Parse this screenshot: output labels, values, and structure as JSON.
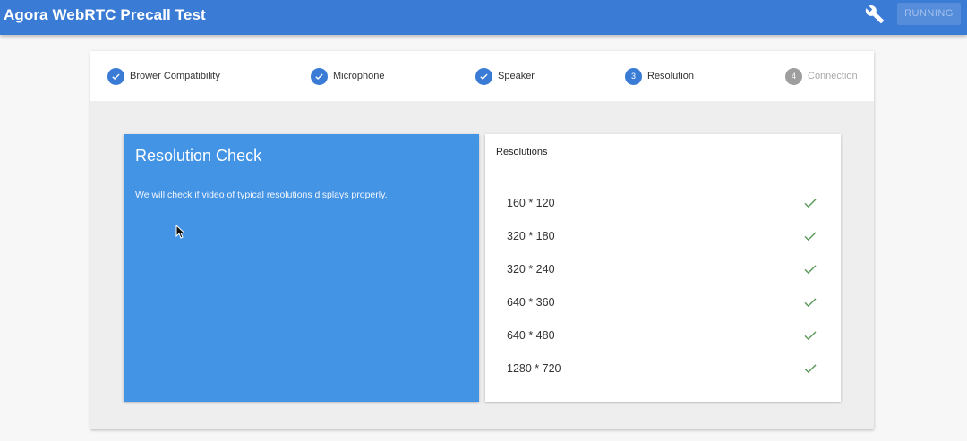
{
  "header": {
    "title": "Agora WebRTC Precall Test",
    "settings_icon": "wrench-icon",
    "running_label": "RUNNING"
  },
  "stepper": {
    "steps": [
      {
        "label": "Brower Compatibility",
        "state": "done",
        "number": ""
      },
      {
        "label": "Microphone",
        "state": "done",
        "number": ""
      },
      {
        "label": "Speaker",
        "state": "done",
        "number": ""
      },
      {
        "label": "Resolution",
        "state": "active",
        "number": "3"
      },
      {
        "label": "Connection",
        "state": "pending",
        "number": "4"
      }
    ]
  },
  "resolution_check": {
    "title": "Resolution Check",
    "description": "We will check if video of typical resolutions displays properly."
  },
  "resolutions": {
    "title": "Resolutions",
    "items": [
      {
        "label": "160 * 120",
        "status": "check-icon"
      },
      {
        "label": "320 * 180",
        "status": "check-icon"
      },
      {
        "label": "320 * 240",
        "status": "check-icon"
      },
      {
        "label": "640 * 360",
        "status": "check-icon"
      },
      {
        "label": "640 * 480",
        "status": "check-icon"
      },
      {
        "label": "1280 * 720",
        "status": "check-icon"
      }
    ]
  },
  "colors": {
    "app_bar": "#3a7bd5",
    "panel_blue": "#4494e6",
    "step_active": "#3a7bd5",
    "step_pending": "#9e9e9e",
    "check_green": "#5b9a5b"
  }
}
